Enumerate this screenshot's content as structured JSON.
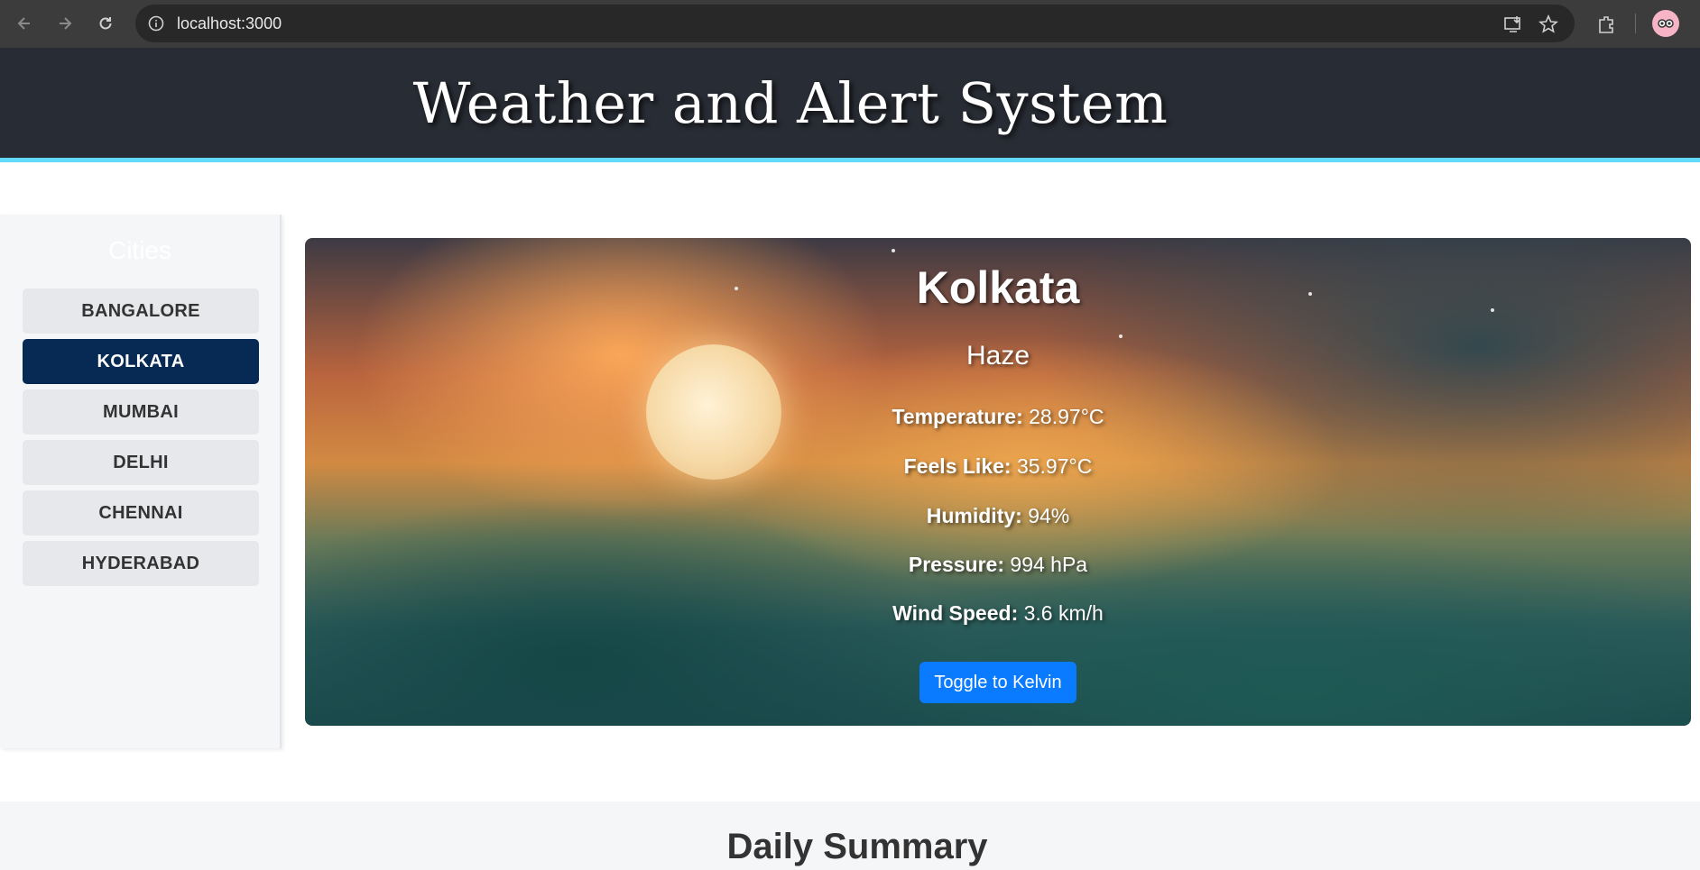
{
  "browser": {
    "url": "localhost:3000",
    "icons": [
      "back-icon",
      "forward-icon",
      "reload-icon",
      "site-info-icon",
      "install-app-icon",
      "bookmark-star-icon",
      "extensions-icon",
      "profile-avatar"
    ]
  },
  "header": {
    "title": "Weather and Alert System"
  },
  "sidebar": {
    "title": "Cities",
    "items": [
      {
        "label": "BANGALORE",
        "active": false
      },
      {
        "label": "KOLKATA",
        "active": true
      },
      {
        "label": "MUMBAI",
        "active": false
      },
      {
        "label": "DELHI",
        "active": false
      },
      {
        "label": "CHENNAI",
        "active": false
      },
      {
        "label": "HYDERABAD",
        "active": false
      }
    ]
  },
  "weather": {
    "city": "Kolkata",
    "condition": "Haze",
    "stats": [
      {
        "label": "Temperature:",
        "value": "28.97°C"
      },
      {
        "label": "Feels Like:",
        "value": "35.97°C"
      },
      {
        "label": "Humidity:",
        "value": "94%"
      },
      {
        "label": "Pressure:",
        "value": "994 hPa"
      },
      {
        "label": "Wind Speed:",
        "value": "3.6 km/h"
      }
    ],
    "toggle_label": "Toggle to Kelvin"
  },
  "summary": {
    "title": "Daily Summary"
  },
  "colors": {
    "header_bg": "#282c34",
    "header_accent": "#61dafb",
    "active_city": "#062a53",
    "toggle_button": "#0a7bff"
  }
}
